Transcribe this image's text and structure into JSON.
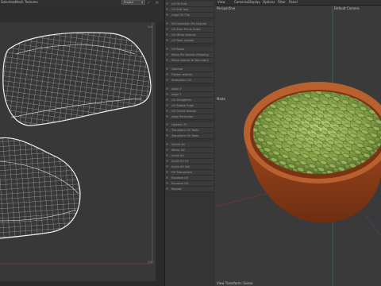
{
  "left_menubar": {
    "items": [
      "Selection",
      "Mesh",
      "Textures"
    ]
  },
  "project_select": "Project",
  "uv_view": {
    "corner_top": "1.0",
    "corner_bottom": "1.0"
  },
  "tool_panel": {
    "items": [
      "UV Fill Edit",
      "UV Edit Tool",
      "Copy UV Tile",
      "Set Selection Pin Islands",
      "UV Zero Pin to Scale",
      "UV Mirror Islands",
      "UV Pack Islands",
      "UV Relax",
      "Relax Pin Islands Relaxing",
      "Relax Islands to Boundary",
      "Optimal",
      "Flatten Islands",
      "Straighten UV",
      "Align X",
      "Align Y",
      "UV Straighten",
      "UV Rotate Edge",
      "UV Orient Islands",
      "Align Perimeter",
      "Update UV",
      "Transform UV Tools",
      "Transform UV Tools",
      "Select All",
      "Mirror UV",
      "Scale UV",
      "Scale UV Fit",
      "Scale UV Set",
      "Fill Triangulate",
      "Equalize UV",
      "Equalize UV",
      "Repeat"
    ]
  },
  "right_menubar": {
    "items": [
      "View",
      "Cameras",
      "Display",
      "Options",
      "Filter",
      "Panel"
    ]
  },
  "viewport": {
    "name": "Perspective",
    "camera": "Default Camera",
    "mode": "Mode",
    "status": "View Transform: Scene"
  },
  "colors": {
    "uv_background": "#383838",
    "uv_wire": "#e6e6e6",
    "bowl_rim": "#b8612e",
    "bowl_body": "#8a3f1a",
    "seeds": "#7e9a45"
  }
}
